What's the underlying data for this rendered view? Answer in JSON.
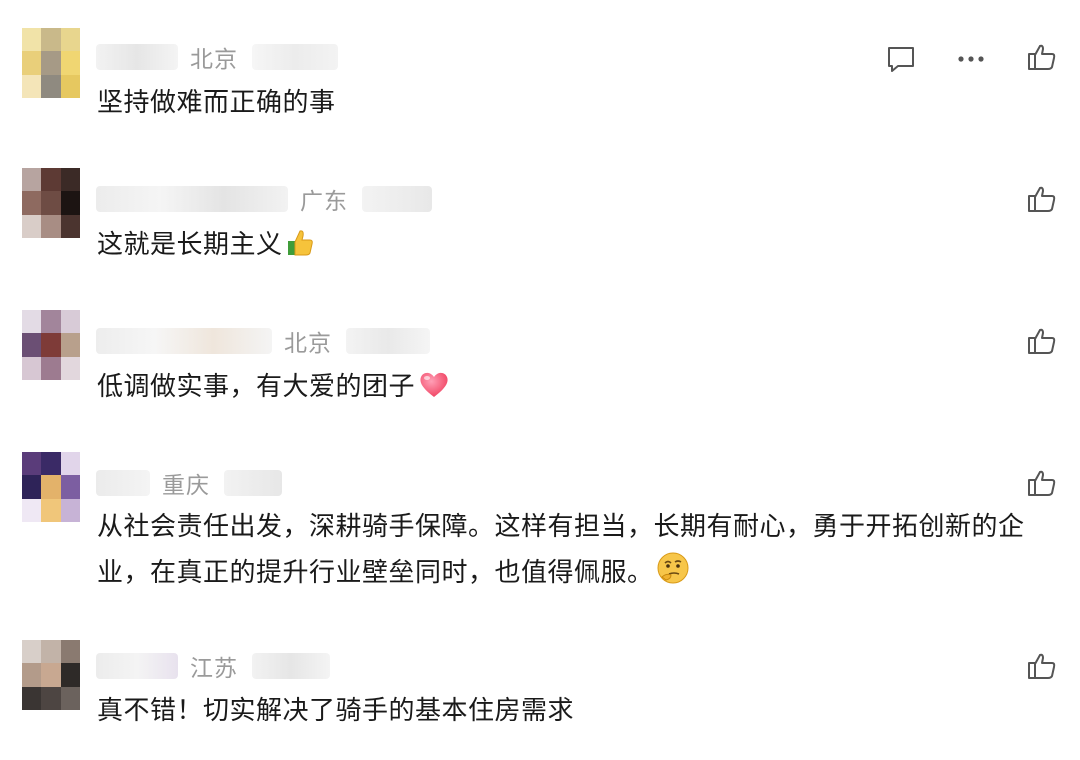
{
  "comments": [
    {
      "location": "北京",
      "text": "坚持做难而正确的事",
      "emoji_icon": "",
      "actions": [
        "reply-icon",
        "more-icon",
        "like-icon"
      ]
    },
    {
      "location": "广东",
      "text": "这就是长期主义",
      "emoji_icon": "thumbs-up-emoji",
      "actions": [
        "like-icon"
      ]
    },
    {
      "location": "北京",
      "text": "低调做实事，有大爱的团子",
      "emoji_icon": "heart-emoji",
      "actions": [
        "like-icon"
      ]
    },
    {
      "location": "重庆",
      "text": "从社会责任出发，深耕骑手保障。这样有担当，长期有耐心，勇于开拓创新的企业，在真正的提升行业壁垒同时，也值得佩服。",
      "emoji_icon": "thinking-face-emoji",
      "actions": [
        "like-icon"
      ]
    },
    {
      "location": "江苏",
      "text": "真不错！切实解决了骑手的基本住房需求",
      "emoji_icon": "",
      "actions": [
        "like-icon"
      ]
    }
  ],
  "colors": {
    "text": "#1a1a1a",
    "location": "#9a9a9a",
    "icon": "#555555",
    "background": "#ffffff"
  }
}
